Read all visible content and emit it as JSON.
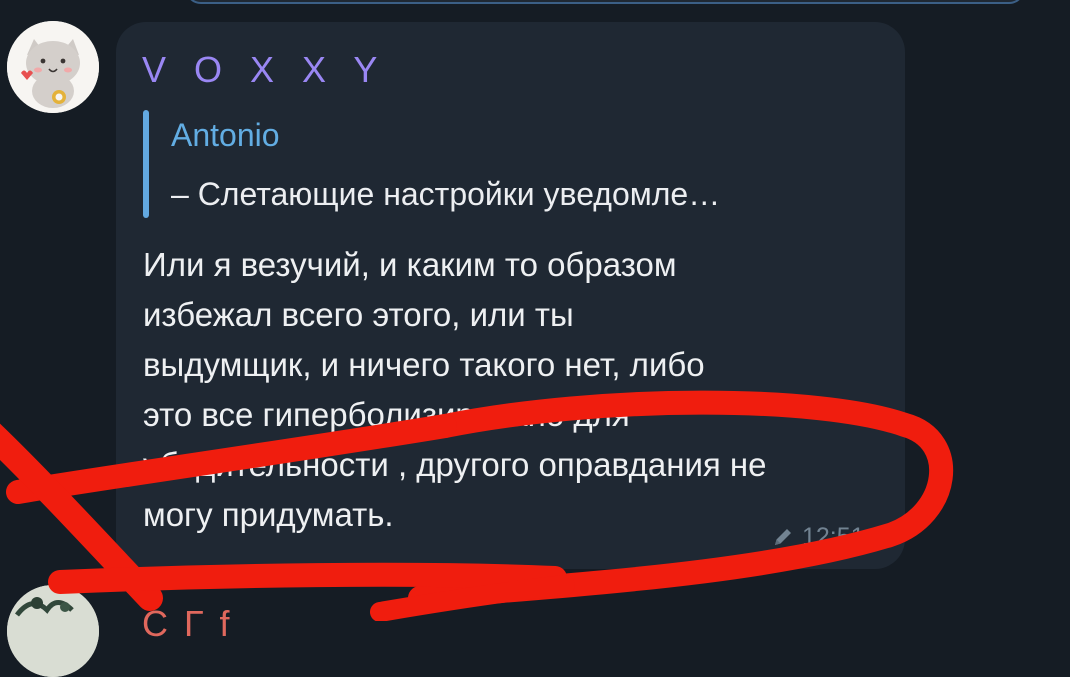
{
  "message": {
    "sender_name": "V O X X Y",
    "reply": {
      "author": "Antonio",
      "preview": "– Слетающие настройки уведомле…"
    },
    "text": "Или я везучий, и каким то образом\nизбежал всего этого, или ты\nвыдумщик, и ничего такого нет, либо\nэто все гиперболизировано для\nубедительности , другого оправдания не\nмогу придумать.",
    "edited_icon": "pencil-icon",
    "time": "12:51"
  },
  "next_message": {
    "sender_name_partial": "С   Г   f"
  },
  "colors": {
    "background": "#151c24",
    "bubble": "#1f2833",
    "sender_name": "#9a87f4",
    "reply_accent": "#63a9e1",
    "text": "#eef0f2",
    "meta": "#728392",
    "annotation_stroke": "#f01d0e"
  }
}
